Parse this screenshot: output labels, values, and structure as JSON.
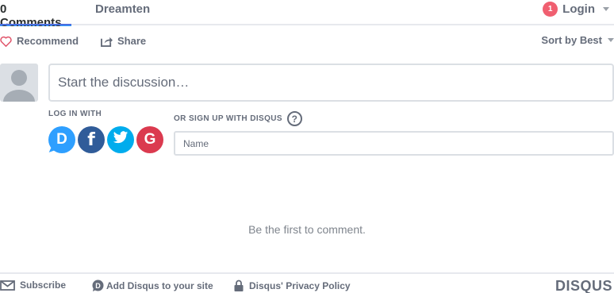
{
  "nav": {
    "comments_tab": "0 Comments",
    "forum_tab": "Dreamten",
    "notification_count": "1",
    "login_label": "Login"
  },
  "actions": {
    "recommend": "Recommend",
    "share": "Share",
    "sort": "Sort by Best"
  },
  "composer": {
    "placeholder": "Start the discussion…"
  },
  "auth": {
    "login_with": "LOG IN WITH",
    "signup_label": "OR SIGN UP WITH DISQUS",
    "help_glyph": "?",
    "name_placeholder": "Name",
    "providers": [
      {
        "name": "disqus-icon",
        "glyph": "D",
        "color": "#2e9fff"
      },
      {
        "name": "facebook-icon",
        "glyph": "f",
        "color": "#305c99"
      },
      {
        "name": "twitter-icon",
        "glyph": "twitter-bird",
        "color": "#00aced"
      },
      {
        "name": "google-icon",
        "glyph": "G",
        "color": "#db3a4f"
      }
    ]
  },
  "empty_state": "Be the first to comment.",
  "footer": {
    "subscribe": "Subscribe",
    "add_disqus": "Add Disqus to your site",
    "privacy": "Disqus' Privacy Policy",
    "brand": "DISQUS"
  },
  "colors": {
    "accent": "#4a6ee0",
    "badge": "#f05f70",
    "text_muted": "#656c7a",
    "border": "#dbdfe4"
  }
}
